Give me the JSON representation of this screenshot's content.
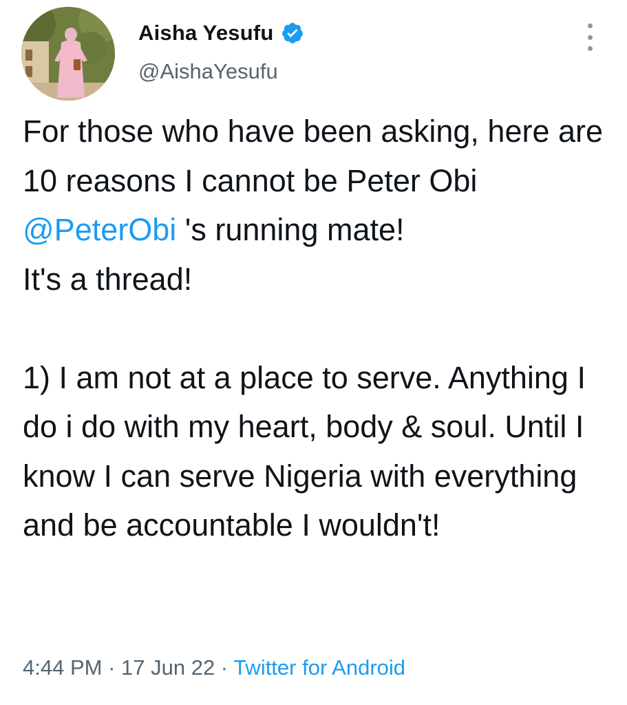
{
  "author": {
    "display_name": "Aisha Yesufu",
    "handle": "@AishaYesufu",
    "verified": true,
    "avatar_icon": "profile-photo",
    "verified_icon": "verified-badge-icon",
    "verified_color": "#1d9bf0"
  },
  "menu": {
    "icon": "more-options-icon"
  },
  "tweet": {
    "text_part1": "For those who have been asking, here are 10 reasons I cannot be Peter Obi ",
    "mention": "@PeterObi",
    "text_part2": " 's running mate!\nIt's a thread!\n\n1) I am not at a place to serve. Anything I do i do with my heart, body & soul. Until I know I can serve Nigeria with everything and be accountable I wouldn't!"
  },
  "meta": {
    "time": "4:44 PM",
    "separator1": " · ",
    "date": "17 Jun 22",
    "separator2": " · ",
    "source": "Twitter for Android"
  },
  "colors": {
    "link": "#1d9bf0",
    "secondary_text": "#536471",
    "primary_text": "#0f1419"
  }
}
